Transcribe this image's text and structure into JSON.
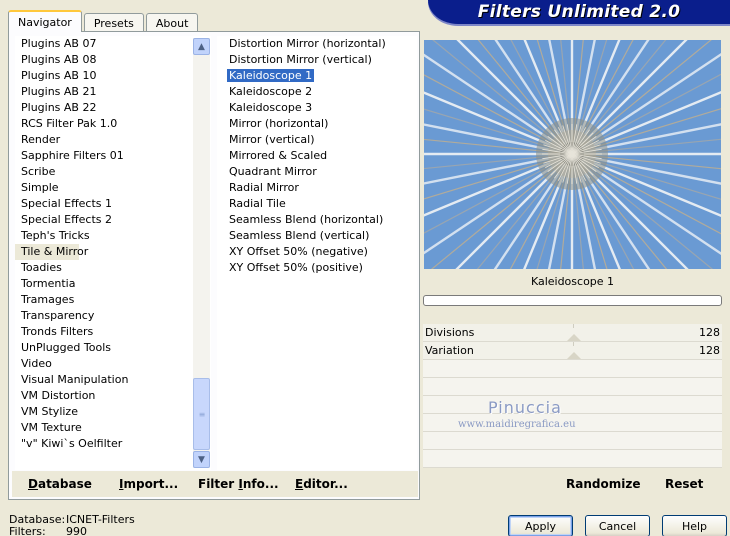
{
  "tabs": [
    {
      "label": "Navigator",
      "active": true
    },
    {
      "label": "Presets",
      "active": false
    },
    {
      "label": "About",
      "active": false
    }
  ],
  "banner_title": "Filters Unlimited 2.0",
  "categories": [
    "Plugins AB 07",
    "Plugins AB 08",
    "Plugins AB 10",
    "Plugins AB 21",
    "Plugins AB 22",
    "RCS Filter Pak 1.0",
    "Render",
    "Sapphire Filters 01",
    "Scribe",
    "Simple",
    "Special Effects 1",
    "Special Effects 2",
    "Teph's Tricks",
    "Tile & Mirror",
    "Toadies",
    "Tormentia",
    "Tramages",
    "Transparency",
    "Tronds Filters",
    "UnPlugged Tools",
    "Video",
    "Visual Manipulation",
    "VM Distortion",
    "VM Stylize",
    "VM Texture",
    "\"v\" Kiwi`s Oelfilter"
  ],
  "selected_category": "Tile & Mirror",
  "filters": [
    "Distortion Mirror (horizontal)",
    "Distortion Mirror (vertical)",
    "Kaleidoscope 1",
    "Kaleidoscope 2",
    "Kaleidoscope 3",
    "Mirror (horizontal)",
    "Mirror (vertical)",
    "Mirrored & Scaled",
    "Quadrant Mirror",
    "Radial Mirror",
    "Radial Tile",
    "Seamless Blend (horizontal)",
    "Seamless Blend (vertical)",
    "XY Offset 50% (negative)",
    "XY Offset 50% (positive)"
  ],
  "selected_filter": "Kaleidoscope 1",
  "left_buttons": {
    "database": {
      "u": "D",
      "rest": "atabase"
    },
    "import": {
      "u": "I",
      "rest": "mport..."
    },
    "filter_info": {
      "pre": "Filter ",
      "u": "I",
      "rest": "nfo..."
    },
    "editor": {
      "u": "E",
      "rest": "ditor..."
    }
  },
  "preview_label": "Kaleidoscope 1",
  "params": [
    {
      "name": "Divisions",
      "value": "128"
    },
    {
      "name": "Variation",
      "value": "128"
    }
  ],
  "watermark": {
    "name": "Pinuccia",
    "url": "www.maidiregrafica.eu"
  },
  "right_buttons": {
    "randomize": "Randomize",
    "reset": "Reset"
  },
  "footer": {
    "database_label": "Database:",
    "database_value": "ICNET-Filters",
    "filters_label": "Filters:",
    "filters_value": "990"
  },
  "dialog_buttons": {
    "apply": "Apply",
    "cancel": "Cancel",
    "help": "Help"
  },
  "icons": {
    "scroll_up": "chevron-up-icon",
    "scroll_down": "chevron-down-icon",
    "grip": "scroll-grip-icon"
  },
  "colors": {
    "banner": "#0a1e8c",
    "selection": "#316ac5",
    "preview_sky": "#6e9ed6"
  }
}
